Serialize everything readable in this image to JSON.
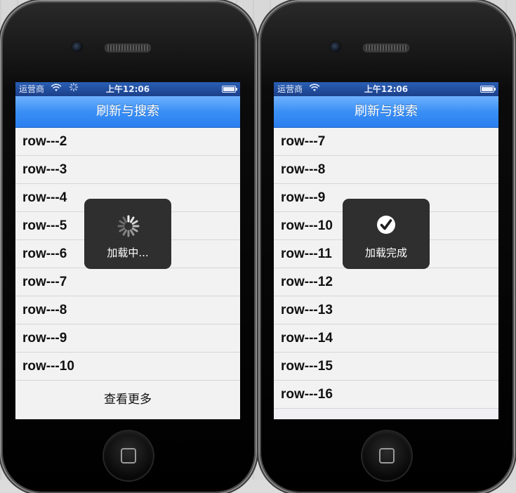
{
  "left_phone": {
    "status_bar": {
      "carrier": "运营商",
      "wifi_icon": "wifi-icon",
      "activity_icon": "network-activity-icon",
      "time": "上午12:06",
      "battery_level": 1.0
    },
    "nav_title": "刷新与搜索",
    "rows": [
      "row---2",
      "row---3",
      "row---4",
      "row---5",
      "row---6",
      "row---7",
      "row---8",
      "row---9",
      "row---10"
    ],
    "more_label": "查看更多",
    "hud": {
      "icon": "spinner-icon",
      "label": "加载中..."
    }
  },
  "right_phone": {
    "status_bar": {
      "carrier": "运营商",
      "wifi_icon": "wifi-icon",
      "time": "上午12:06",
      "battery_level": 1.0
    },
    "nav_title": "刷新与搜索",
    "rows": [
      "row---7",
      "row---8",
      "row---9",
      "row---10",
      "row---11",
      "row---12",
      "row---13",
      "row---14",
      "row---15",
      "row---16"
    ],
    "hud": {
      "icon": "checkmark-icon",
      "label": "加载完成"
    }
  },
  "colors": {
    "nav_bar": "#3a8ff5",
    "status_bar": "#1b3f88",
    "hud_background": "#1e1e1e",
    "row_background": "#f2f2f2"
  }
}
